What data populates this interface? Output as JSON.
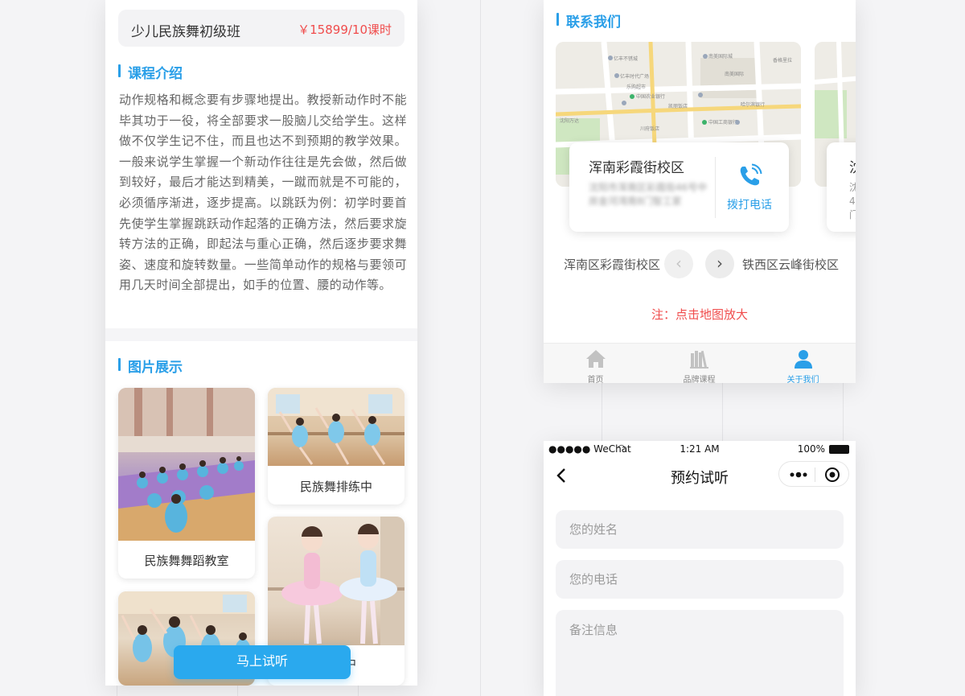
{
  "left_phone": {
    "course": {
      "name": "少儿民族舞初级班",
      "price": "￥15899/10课时"
    },
    "intro": {
      "title": "课程介绍",
      "text": "动作规格和概念要有步骤地提出。教授新动作时不能毕其功于一役，将全部要求一股脑儿交给学生。这样做不仅学生记不住，而且也达不到预期的教学效果。一般来说学生掌握一个新动作往往是先会做，然后做到较好，最后才能达到精美，一蹴而就是不可能的，必须循序渐进，逐步提高。以跳跃为例：初学时要首先使学生掌握跳跃动作起落的正确方法，然后要求旋转方法的正确，即起法与重心正确，然后逐步要求舞姿、速度和旋转数量。一些简单动作的规格与要领可用几天时间全部提出，如手的位置、腰的动作等。"
    },
    "gallery": {
      "title": "图片展示",
      "items": [
        {
          "caption": "民族舞舞蹈教室"
        },
        {
          "caption": "民族舞排练中"
        },
        {
          "caption": ""
        },
        {
          "caption": "练中"
        }
      ]
    },
    "cta": {
      "label": "马上试听"
    }
  },
  "contact_phone": {
    "title": "联系我们",
    "campus": {
      "name": "浑南彩霞街校区",
      "address": "沈阳市浑南区彩霞街46号中房金河湾南8门智工家",
      "call_label": "拨打电话"
    },
    "campus_next_peek": {
      "name": "沈",
      "address": "沈4门"
    },
    "nav": {
      "prev": "浑南区彩霞街校区",
      "next": "铁西区云峰街校区"
    },
    "note": "注：点击地图放大",
    "tabbar": [
      {
        "label": "首页",
        "icon": "home-icon",
        "active": false
      },
      {
        "label": "品牌课程",
        "icon": "books-icon",
        "active": false
      },
      {
        "label": "关于我们",
        "icon": "user-icon",
        "active": true
      }
    ],
    "accent": "#2a9fe8",
    "note_color": "#f04c4c"
  },
  "booking_phone": {
    "status": {
      "carrier": "●●●●● WeChat",
      "time": "1:21 AM",
      "battery": "100%"
    },
    "title": "预约试听",
    "fields": {
      "name_placeholder": "您的姓名",
      "phone_placeholder": "您的电话",
      "note_placeholder": "备注信息"
    }
  }
}
